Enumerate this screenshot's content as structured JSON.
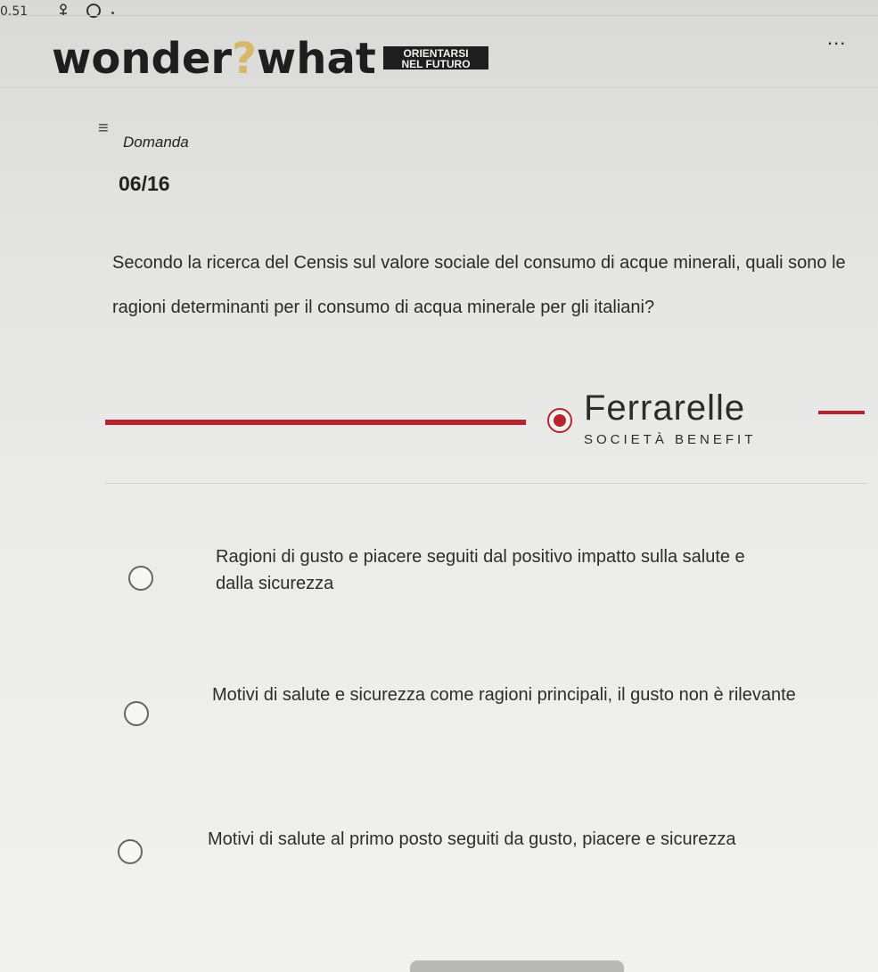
{
  "status": {
    "time": "0.51"
  },
  "header": {
    "logo_part1": "wonder",
    "logo_q": "?",
    "logo_part2": "what",
    "badge_line1": "ORIENTARSI",
    "badge_line2": "NEL FUTURO",
    "menu": "..."
  },
  "quiz": {
    "kicker": "Domanda",
    "counter": "06/16",
    "question": "Secondo la ricerca del Censis sul valore sociale del consumo di acque minerali, quali sono le ragioni determinanti per il consumo di acqua minerale per gli italiani?"
  },
  "sponsor": {
    "name": "Ferrarelle",
    "subtitle": "SOCIETÀ BENEFIT"
  },
  "options": [
    {
      "text": "Ragioni di gusto e piacere seguiti dal positivo impatto sulla salute e dalla sicurezza"
    },
    {
      "text": "Motivi di salute e sicurezza come ragioni principali, il gusto non è rilevante"
    },
    {
      "text": "Motivi di salute al primo posto seguiti da gusto, piacere e sicurezza"
    }
  ],
  "colors": {
    "accent_red": "#b8242d",
    "logo_question": "#d7b86a"
  }
}
